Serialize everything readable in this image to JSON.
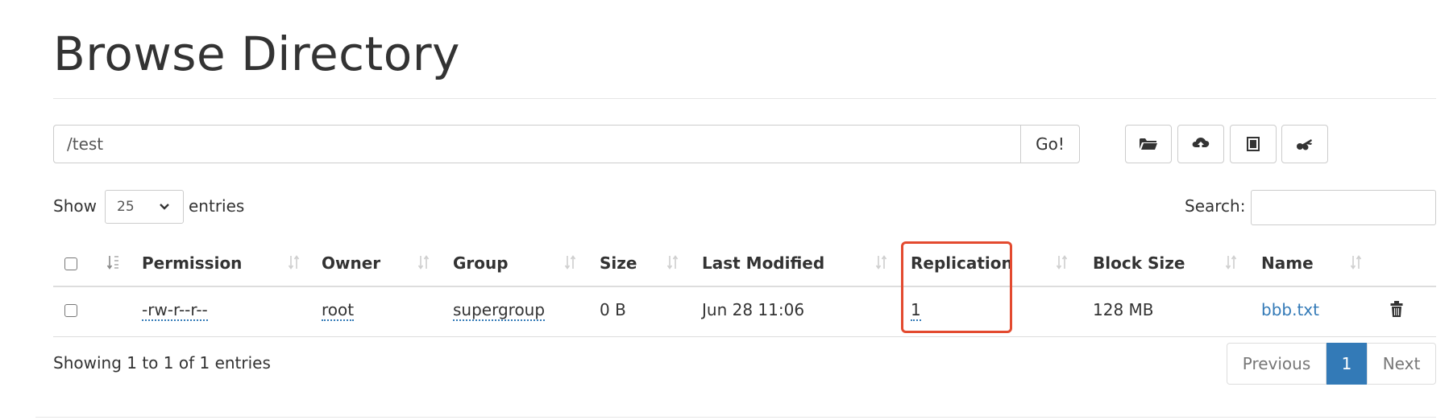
{
  "page": {
    "title": "Browse Directory"
  },
  "toolbar": {
    "path_value": "/test",
    "go_label": "Go!",
    "buttons": [
      {
        "icon": "folder-open-icon"
      },
      {
        "icon": "cloud-upload-icon"
      },
      {
        "icon": "book-icon"
      },
      {
        "icon": "cut-icon"
      }
    ]
  },
  "controls": {
    "show_label": "Show",
    "entries_value": "25",
    "entries_label": "entries",
    "search_label": "Search:",
    "search_value": ""
  },
  "table": {
    "columns": [
      "Permission",
      "Owner",
      "Group",
      "Size",
      "Last Modified",
      "Replication",
      "Block Size",
      "Name"
    ],
    "rows": [
      {
        "permission": "-rw-r--r--",
        "owner": "root",
        "group": "supergroup",
        "size": "0 B",
        "last_modified": "Jun 28 11:06",
        "replication": "1",
        "block_size": "128 MB",
        "name": "bbb.txt",
        "action_icon": "trash-icon"
      }
    ]
  },
  "footer": {
    "info": "Showing 1 to 1 of 1 entries",
    "previous_label": "Previous",
    "current_page": "1",
    "next_label": "Next"
  },
  "colors": {
    "accent": "#337ab7",
    "highlight": "#e34a2f",
    "border": "#cccccc"
  }
}
